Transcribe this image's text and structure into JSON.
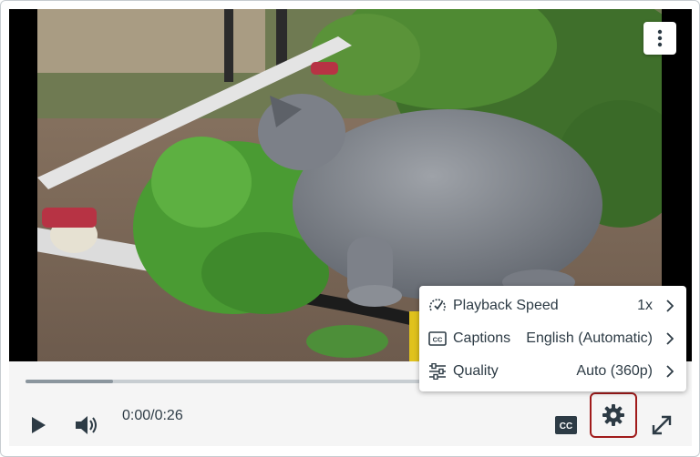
{
  "player": {
    "time_display": "0:00/0:26",
    "progress": 0.135
  },
  "menu": {
    "items": [
      {
        "label": "Playback Speed",
        "value": "1x",
        "icon": "playback-speed-icon"
      },
      {
        "label": "Captions",
        "value": "English (Automatic)",
        "icon": "cc-icon"
      },
      {
        "label": "Quality",
        "value": "Auto (360p)",
        "icon": "sliders-icon"
      }
    ]
  },
  "colors": {
    "accent_focus": "#a01b1b",
    "text": "#2d3b45",
    "controls_bg": "#f5f5f5"
  }
}
